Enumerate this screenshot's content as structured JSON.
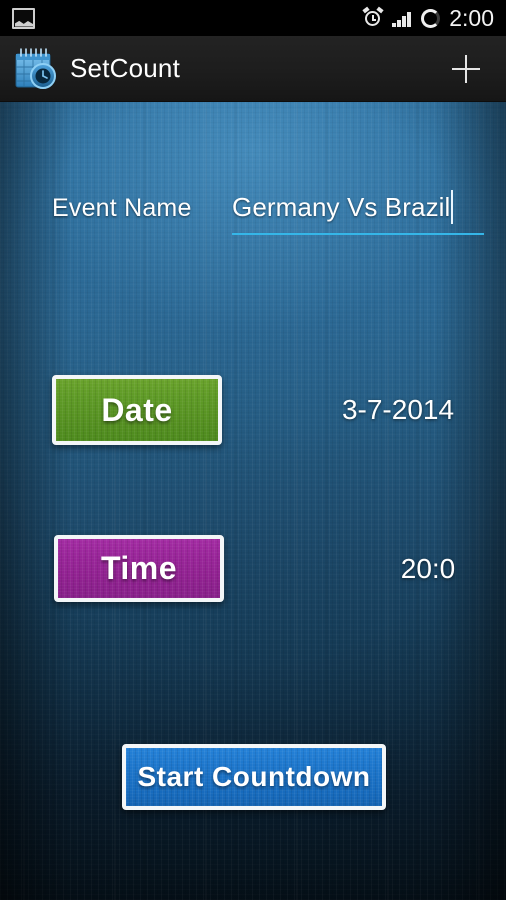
{
  "status_bar": {
    "notification_icon": "photo-icon",
    "alarm_icon": "alarm-clock-icon",
    "signal_icon": "signal-bars-icon",
    "sync_icon": "circle-ring-icon",
    "clock": "2:00"
  },
  "action_bar": {
    "app_icon": "calendar-clock-icon",
    "title": "SetCount",
    "add_label": "add-icon"
  },
  "form": {
    "event_name_label": "Event Name",
    "event_name_value": "Germany Vs Brazil",
    "event_name_placeholder": "Event Name",
    "date_button_label": "Date",
    "date_value": "3-7-2014",
    "time_button_label": "Time",
    "time_value": "20:0",
    "start_button_label": "Start Countdown"
  },
  "colors": {
    "status_bar_bg": "#000000",
    "action_bar_bg": "#1d1d1d",
    "background_top": "#2f72a0",
    "background_bottom": "#06141f",
    "date_button": "#559021",
    "time_button": "#8f218f",
    "start_button": "#186dc0",
    "underline_accent": "#35b6e8",
    "text_primary": "#ffffff"
  }
}
